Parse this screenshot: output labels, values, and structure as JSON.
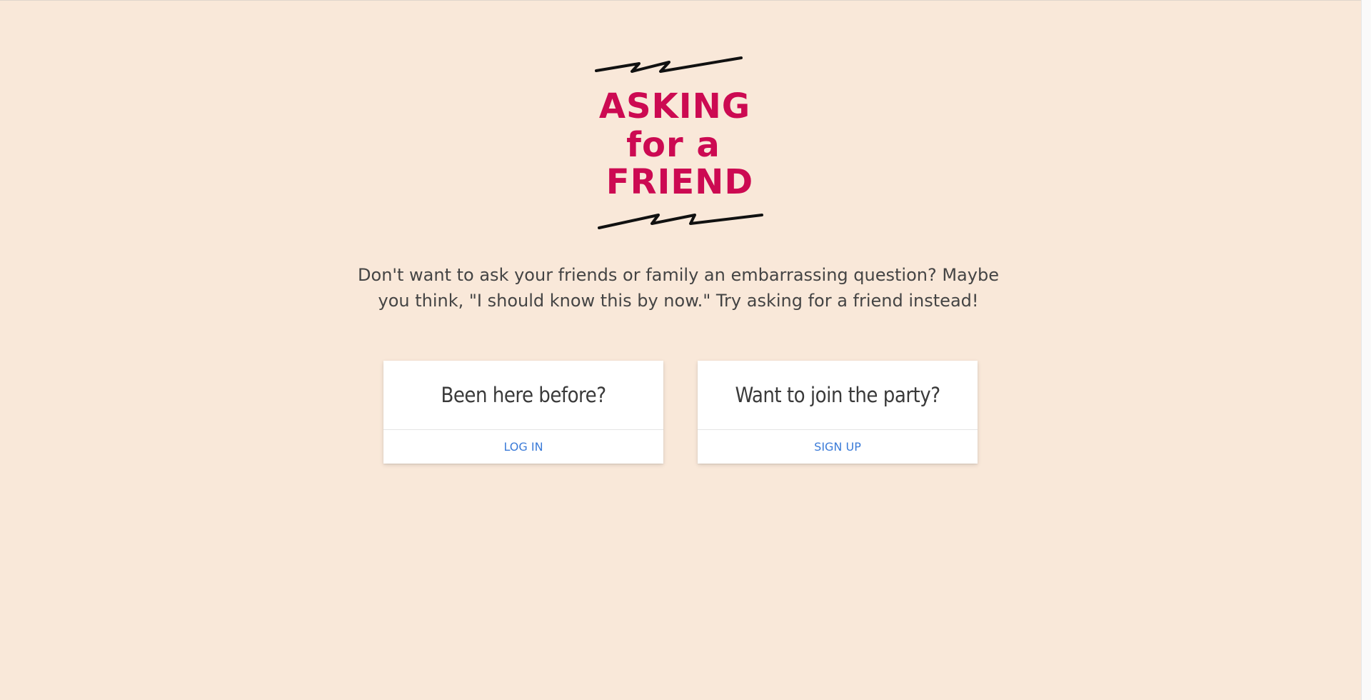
{
  "logo": {
    "line1": "ASKING",
    "line2": "for a",
    "line3": "FRIEND",
    "text_color": "#cc0a52",
    "line_color": "#111111"
  },
  "tagline": "Don't want to ask your friends or family an embarrassing question? Maybe you think, \"I should know this by now.\" Try asking for a friend instead!",
  "cards": {
    "login": {
      "title": "Been here before?",
      "action": "LOG IN"
    },
    "signup": {
      "title": "Want to join the party?",
      "action": "SIGN UP"
    }
  },
  "colors": {
    "background": "#f9e8d9",
    "link": "#3b7bd8",
    "text": "#444444"
  }
}
